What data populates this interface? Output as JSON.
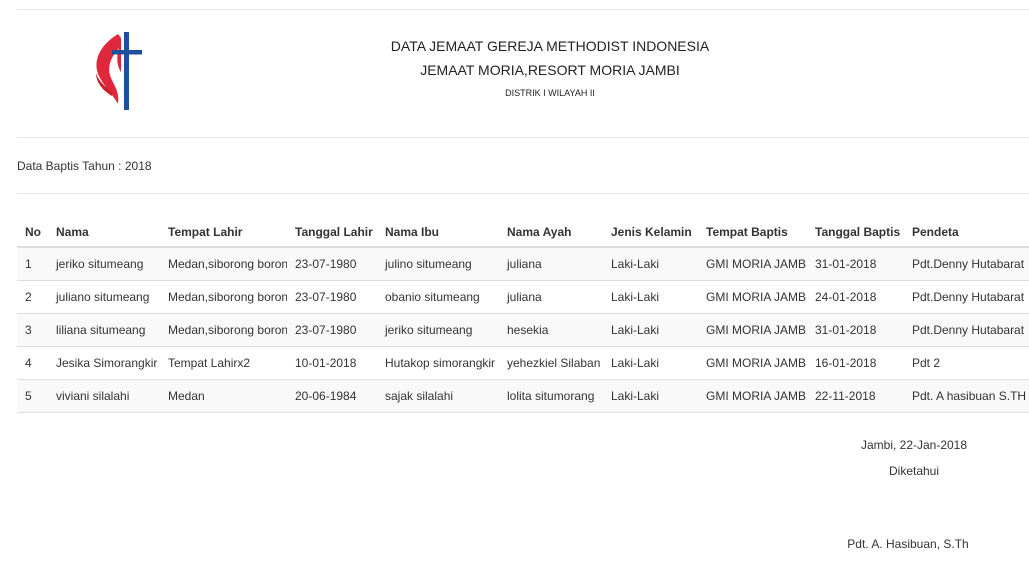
{
  "header": {
    "title_line1": "DATA JEMAAT GEREJA METHODIST INDONESIA",
    "title_line2": "JEMAAT MORIA,RESORT MORIA JAMBI",
    "title_line3": "DISTRIK I WILAYAH II",
    "logo_icon": "methodist-cross-flame-icon"
  },
  "subtitle": "Data Baptis Tahun : 2018",
  "table": {
    "columns": [
      "No",
      "Nama",
      "Tempat Lahir",
      "Tanggal Lahir",
      "Nama Ibu",
      "Nama Ayah",
      "Jenis Kelamin",
      "Tempat Baptis",
      "Tanggal Baptis",
      "Pendeta"
    ],
    "rows": [
      [
        "1",
        "jeriko situmeang",
        "Medan,siborong boron",
        "23-07-1980",
        "julino situmeang",
        "juliana",
        "Laki-Laki",
        "GMI MORIA JAMBI",
        "31-01-2018",
        "Pdt.Denny Hutabarat"
      ],
      [
        "2",
        "juliano situmeang",
        "Medan,siborong boron",
        "23-07-1980",
        "obanio situmeang",
        "juliana",
        "Laki-Laki",
        "GMI MORIA JAMBI",
        "24-01-2018",
        "Pdt.Denny Hutabarat"
      ],
      [
        "3",
        "liliana situmeang",
        "Medan,siborong boron",
        "23-07-1980",
        "jeriko situmeang",
        "hesekia",
        "Laki-Laki",
        "GMI MORIA JAMBI",
        "31-01-2018",
        "Pdt.Denny Hutabarat"
      ],
      [
        "4",
        "Jesika Simorangkir",
        "Tempat Lahirx2",
        "10-01-2018",
        "Hutakop simorangkir",
        "yehezkiel Silaban",
        "Laki-Laki",
        "GMI MORIA JAMBI",
        "16-01-2018",
        "Pdt 2"
      ],
      [
        "5",
        "viviani silalahi",
        "Medan",
        "20-06-1984",
        "sajak silalahi",
        "lolita situmorang",
        "Laki-Laki",
        "GMI MORIA JAMBI",
        "22-11-2018",
        "Pdt. A hasibuan S.TH"
      ]
    ]
  },
  "signature": {
    "place_date": "Jambi, 22-Jan-2018",
    "acknowledged": "Diketahui",
    "name": "Pdt. A. Hasibuan, S.Th"
  },
  "colors": {
    "flame_red": "#e0283c",
    "cross_blue": "#1e4f9c",
    "border": "#dddddd",
    "stripe": "#f9f9f9"
  }
}
